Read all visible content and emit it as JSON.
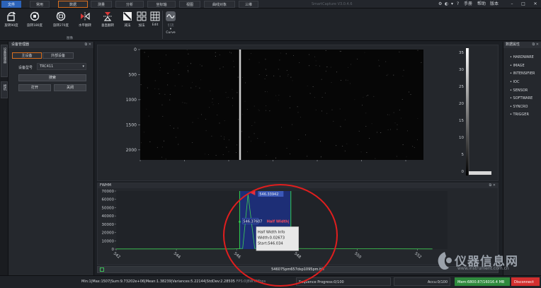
{
  "menu": {
    "tabs": [
      "文件",
      "常用",
      "数据",
      "测量",
      "分析",
      "坐标轴",
      "视图",
      "曲线对象",
      "三维"
    ],
    "active_index": 0,
    "highlight_index": 2,
    "app_title": "SmartCapture V3.0.4.6",
    "right_items": [
      "手册",
      "帮助",
      "版本"
    ]
  },
  "ribbon": {
    "buttons": [
      "旋转90度",
      "旋转180度",
      "旋转270度",
      "水平翻转",
      "垂直翻转",
      "减法",
      "加法",
      "Edit",
      "Curve"
    ],
    "disabled_label": "引流",
    "group_label": "图像"
  },
  "left_panel": {
    "vertical_tabs": [
      "设备管理器",
      "相机"
    ],
    "title": "设备管理器",
    "subtabs": [
      "主设备",
      "外部设备"
    ],
    "device_type_label": "设备型号",
    "device_type_value": "TRC411",
    "search_button": "搜索",
    "open_button": "打开",
    "close_button": "关闭"
  },
  "image_view": {
    "y_ticks": [
      "0",
      "500",
      "1000",
      "1500",
      "2000"
    ],
    "x_ticks": [
      "0",
      "500",
      "1000",
      "1500",
      "2000",
      "2500",
      "3000"
    ],
    "colorbar_ticks": [
      "35",
      "30",
      "25",
      "20",
      "15",
      "10",
      "5",
      "0"
    ]
  },
  "fwhm": {
    "title": "FWHM",
    "marker_label_top": "546.33942",
    "marker_label_mid": "546.37607",
    "half_width_label": "Half Width|",
    "info_lines": [
      "Half Width Info",
      "Width:0.02673",
      "Start:546.034"
    ]
  },
  "chart_data": {
    "type": "line",
    "title": "FWHM",
    "xlabel": "",
    "ylabel": "",
    "x_ticks": [
      "542",
      "544",
      "546",
      "548",
      "550",
      "552"
    ],
    "y_ticks": [
      "70000",
      "60000",
      "50000",
      "40000",
      "30000",
      "20000",
      "10000",
      "0"
    ],
    "ylim": [
      0,
      70000
    ],
    "xlim": [
      542,
      553
    ],
    "series": [
      {
        "x": [
          542,
          545.9,
          546.2,
          546.38,
          546.6,
          552.5
        ],
        "y": [
          200,
          200,
          800,
          66000,
          800,
          200
        ]
      }
    ]
  },
  "file_bar": {
    "filename": "546075pm657dsp1095pm.tiff"
  },
  "right_panel": {
    "title": "数据属性",
    "items": [
      "HARDWARE",
      "IMAGE",
      "INTENSIFIER",
      "IOC",
      "SENSOR",
      "SOFTWARE",
      "SYNCRO",
      "TRIGGER"
    ]
  },
  "status": {
    "stats": "Min:1|Max:1507|Sum:9.73202e+06|Mean:1.38239|Variances:5.22144|StdDev:2.28505",
    "fps": "FPS:0|BW:0Mbps",
    "sequence": "Sequence Progress:0/100",
    "accu": "Accu:0/100",
    "mem": "Mem:6800.87/16016.4 MB",
    "connection": "Disconnect"
  },
  "watermark": {
    "text": "仪器信息网",
    "url": "www.instrument.com.cn"
  },
  "colors": {
    "accent": "#2c63b8",
    "orange": "#d96f1f",
    "green": "#2f8a3d",
    "red": "#d22f2f"
  }
}
